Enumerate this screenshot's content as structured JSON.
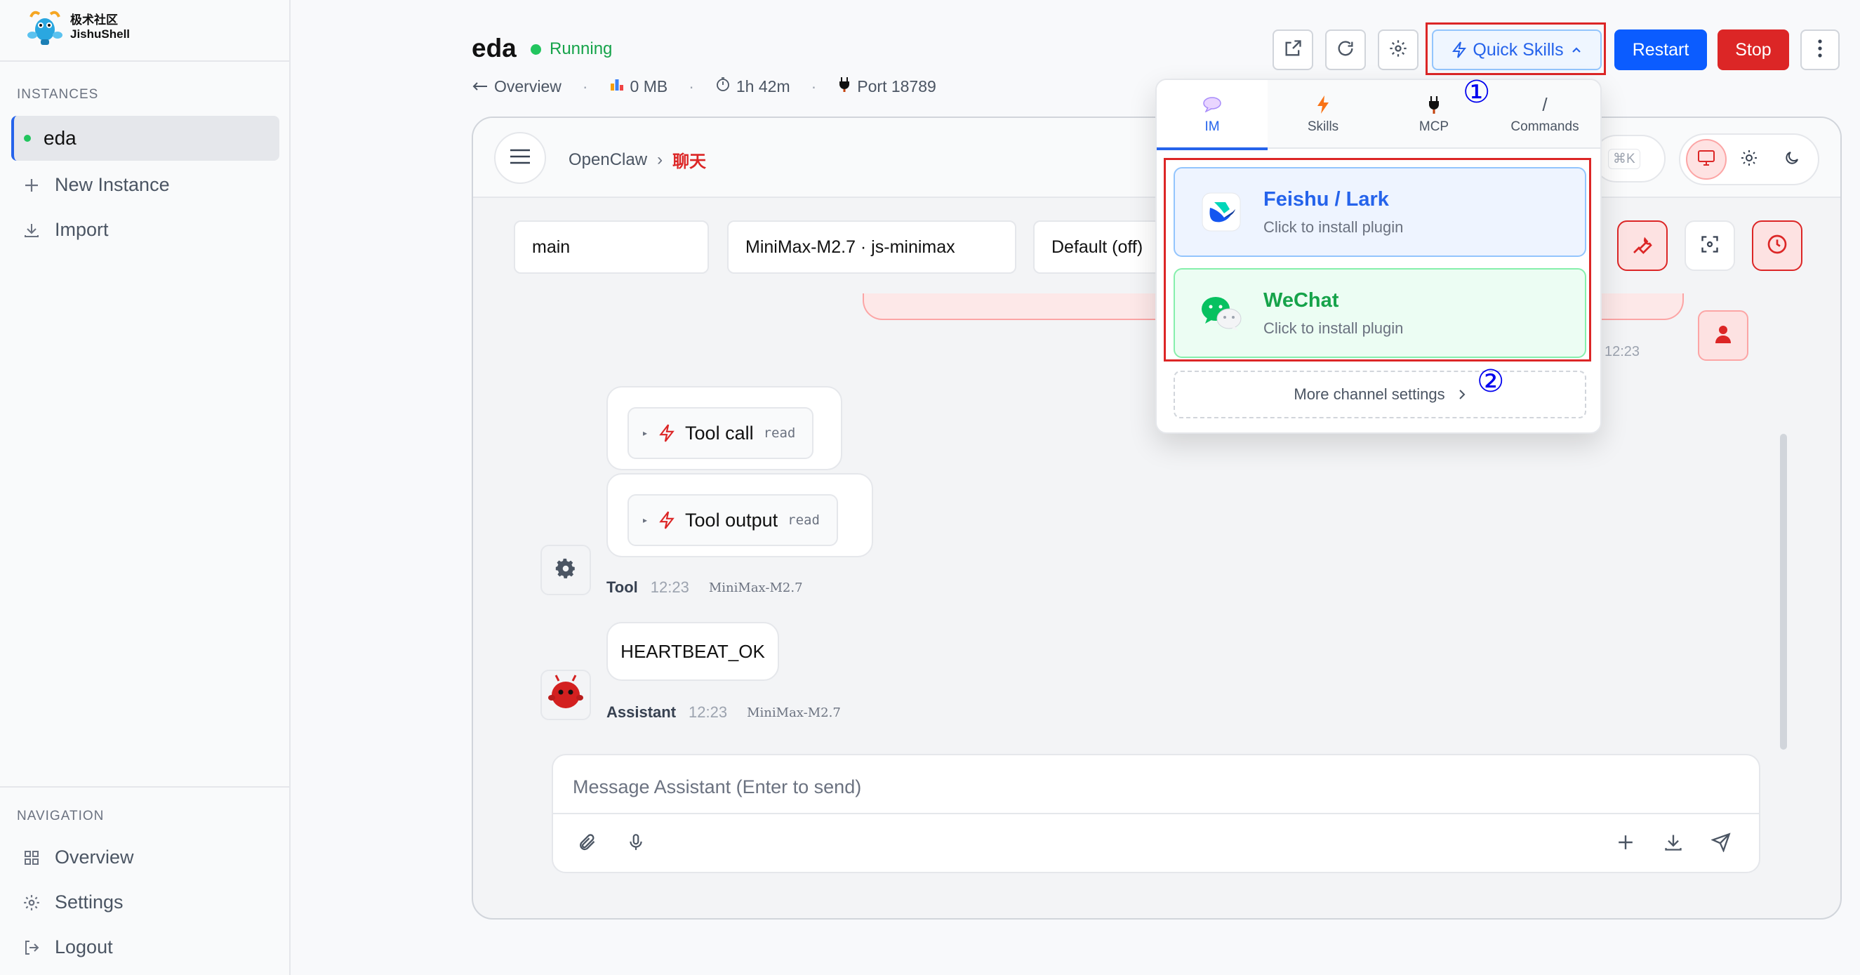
{
  "brand": {
    "cn": "极术社区",
    "en": "JishuShell"
  },
  "sidebar": {
    "instances_label": "INSTANCES",
    "instance": "eda",
    "new_instance": "New Instance",
    "import": "Import",
    "navigation_label": "NAVIGATION",
    "nav": {
      "overview": "Overview",
      "settings": "Settings",
      "logout": "Logout"
    }
  },
  "header": {
    "title": "eda",
    "status": "Running",
    "overview": "Overview",
    "memory": "0 MB",
    "uptime": "1h 42m",
    "port": "Port 18789",
    "quick_skills": "Quick Skills",
    "restart": "Restart",
    "stop": "Stop"
  },
  "chat": {
    "breadcrumb": {
      "root": "OpenClaw",
      "current": "聊天"
    },
    "shortcut": "⌘K",
    "selects": {
      "agent": "main",
      "model": "MiniMax-M2.7 · js-minimax",
      "thinking": "Default (off)"
    },
    "user_time": "12:23",
    "tool_call": {
      "label": "Tool call",
      "tag": "read"
    },
    "tool_output": {
      "label": "Tool output",
      "tag": "read"
    },
    "tool_meta": {
      "who": "Tool",
      "time": "12:23",
      "model": "MiniMax-M2.7"
    },
    "assistant_text": "HEARTBEAT_OK",
    "assistant_meta": {
      "who": "Assistant",
      "time": "12:23",
      "model": "MiniMax-M2.7"
    },
    "composer_placeholder": "Message Assistant (Enter to send)"
  },
  "dropdown": {
    "tabs": [
      {
        "label": "IM",
        "icon": "speech-bubble-icon"
      },
      {
        "label": "Skills",
        "icon": "bolt-icon"
      },
      {
        "label": "MCP",
        "icon": "plug-icon"
      },
      {
        "label": "Commands",
        "icon": "/"
      }
    ],
    "cards": [
      {
        "name": "Feishu / Lark",
        "sub": "Click to install plugin"
      },
      {
        "name": "WeChat",
        "sub": "Click to install plugin"
      }
    ],
    "more": "More channel settings"
  },
  "annotations": {
    "one": "①",
    "two": "②"
  },
  "colors": {
    "accent": "#2563eb",
    "danger": "#dc2626",
    "success": "#22c55e",
    "wechat": "#07c160"
  }
}
